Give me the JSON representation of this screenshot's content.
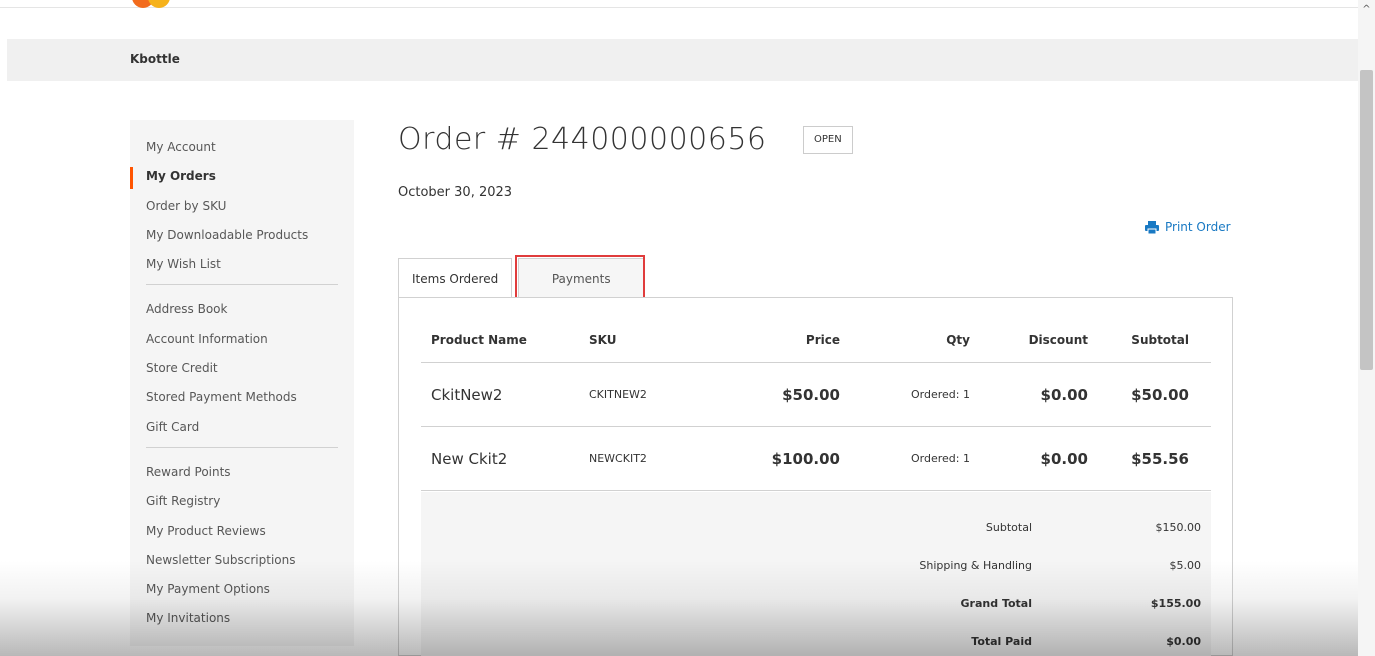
{
  "store": {
    "name": "Kbottle"
  },
  "sidebar": {
    "groups": [
      [
        "My Account",
        "My Orders",
        "Order by SKU",
        "My Downloadable Products",
        "My Wish List"
      ],
      [
        "Address Book",
        "Account Information",
        "Store Credit",
        "Stored Payment Methods",
        "Gift Card"
      ],
      [
        "Reward Points",
        "Gift Registry",
        "My Product Reviews",
        "Newsletter Subscriptions",
        "My Payment Options",
        "My Invitations"
      ]
    ],
    "active": "My Orders"
  },
  "order": {
    "title": "Order # 244000000656",
    "status": "OPEN",
    "date": "October 30, 2023",
    "print_label": "Print Order"
  },
  "tabs": [
    {
      "label": "Items Ordered",
      "active": true
    },
    {
      "label": "Payments",
      "active": false
    }
  ],
  "items_table": {
    "headers": [
      "Product Name",
      "SKU",
      "Price",
      "Qty",
      "Discount",
      "Subtotal"
    ],
    "rows": [
      [
        "CkitNew2",
        "CKITNEW2",
        "$50.00",
        "Ordered: 1",
        "$0.00",
        "$50.00"
      ],
      [
        "New Ckit2",
        "NEWCKIT2",
        "$100.00",
        "Ordered: 1",
        "$0.00",
        "$55.56"
      ]
    ]
  },
  "totals": [
    {
      "label": "Subtotal",
      "value": "$150.00",
      "bold": false
    },
    {
      "label": "Shipping & Handling",
      "value": "$5.00",
      "bold": false
    },
    {
      "label": "Grand Total",
      "value": "$155.00",
      "bold": true
    },
    {
      "label": "Total Paid",
      "value": "$0.00",
      "bold": true
    }
  ],
  "colors": {
    "accent": "#ff5501",
    "link": "#1979c3",
    "highlight": "#e03c3c"
  },
  "icons": {
    "print": "printer-icon",
    "scroll_up": "chevron-up-icon"
  }
}
